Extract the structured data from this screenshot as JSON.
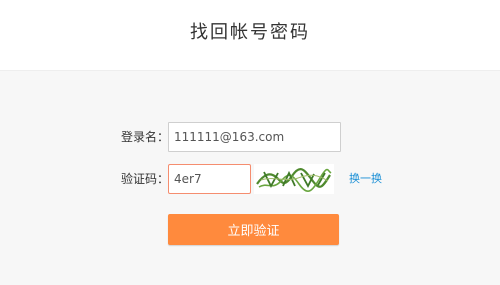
{
  "page": {
    "title": "找回帐号密码"
  },
  "form": {
    "username_label": "登录名：",
    "username_value": "111111@163.com",
    "captcha_label": "验证码：",
    "captcha_value": "4er7",
    "refresh_link": "换一换",
    "submit_label": "立即验证"
  },
  "colors": {
    "accent": "#ff8a3d",
    "link": "#1a8fd6",
    "captcha_ink": "#4f8a2e"
  }
}
